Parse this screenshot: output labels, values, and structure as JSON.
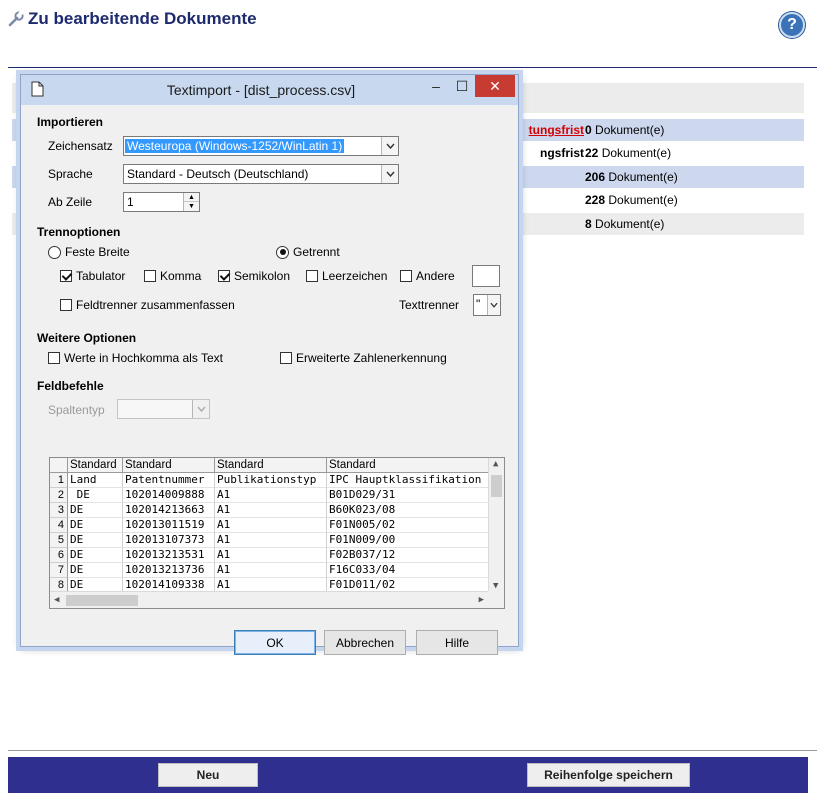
{
  "page": {
    "title": "Zu bearbeitende Dokumente",
    "help_label": "?",
    "rows": [
      {
        "label": "tungsfrist",
        "label_is_link": true,
        "count": "0",
        "unit": "Dokument(e)",
        "shaded": true
      },
      {
        "label": "ngsfrist",
        "label_is_link": false,
        "count": "22",
        "unit": "Dokument(e)",
        "shaded": false
      },
      {
        "label": "",
        "label_is_link": false,
        "count": "206",
        "unit": "Dokument(e)",
        "shaded": true
      },
      {
        "label": "",
        "label_is_link": false,
        "count": "228",
        "unit": "Dokument(e)",
        "shaded": false
      },
      {
        "label": "",
        "label_is_link": false,
        "count": "8",
        "unit": "Dokument(e)",
        "shaded": true
      }
    ],
    "footer": {
      "new_label": "Neu",
      "save_order_label": "Reihenfolge speichern"
    },
    "colors": {
      "accent": "#1e2a6e",
      "footer": "#2f2f8f",
      "row_shade_blue": "#cdd8ee",
      "row_shade_gray": "#ececec",
      "link": "#d40000"
    }
  },
  "dialog": {
    "title": "Textimport - [dist_process.csv]",
    "window_buttons": {
      "minimize": "–",
      "maximize": "☐",
      "close": "✕"
    },
    "import": {
      "section_label": "Importieren",
      "charset_label": "Zeichensatz",
      "charset_value": "Westeuropa (Windows-1252/WinLatin 1)",
      "language_label": "Sprache",
      "language_value": "Standard - Deutsch (Deutschland)",
      "from_row_label": "Ab Zeile",
      "from_row_value": "1"
    },
    "separator": {
      "section_label": "Trennoptionen",
      "fixed_width_label": "Feste Breite",
      "separated_label": "Getrennt",
      "separated_selected": true,
      "tab_label": "Tabulator",
      "tab_checked": true,
      "comma_label": "Komma",
      "comma_checked": false,
      "semicolon_label": "Semikolon",
      "semicolon_checked": true,
      "space_label": "Leerzeichen",
      "space_checked": false,
      "other_label": "Andere",
      "other_checked": false,
      "other_value": "",
      "merge_label": "Feldtrenner zusammenfassen",
      "merge_checked": false,
      "text_delimiter_label": "Texttrenner",
      "text_delimiter_value": "\""
    },
    "further": {
      "section_label": "Weitere Optionen",
      "quoted_label": "Werte in Hochkomma als Text",
      "quoted_checked": false,
      "detect_label": "Erweiterte Zahlenerkennung",
      "detect_checked": false
    },
    "fields": {
      "section_label": "Feldbefehle",
      "column_type_label": "Spaltentyp",
      "column_type_value": ""
    },
    "preview": {
      "headers": [
        "Standard",
        "Standard",
        "Standard",
        "Standard"
      ],
      "rows": [
        [
          "1",
          "Land",
          "Patentnummer",
          "Publikationstyp",
          "IPC Hauptklassifikation"
        ],
        [
          "2",
          " DE",
          "102014009888",
          "A1",
          "B01D029/31"
        ],
        [
          "3",
          "DE",
          "102014213663",
          "A1",
          "B60K023/08"
        ],
        [
          "4",
          "DE",
          "102013011519",
          "A1",
          "F01N005/02"
        ],
        [
          "5",
          "DE",
          "102013107373",
          "A1",
          "F01N009/00"
        ],
        [
          "6",
          "DE",
          "102013213531",
          "A1",
          "F02B037/12"
        ],
        [
          "7",
          "DE",
          "102013213736",
          "A1",
          "F16C033/04"
        ],
        [
          "8",
          "DE",
          "102014109338",
          "A1",
          "F01D011/02"
        ]
      ]
    },
    "buttons": {
      "ok": "OK",
      "cancel": "Abbrechen",
      "help": "Hilfe"
    }
  }
}
